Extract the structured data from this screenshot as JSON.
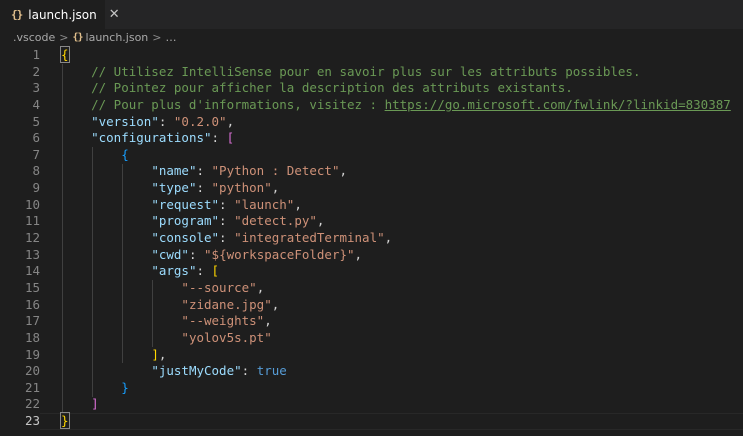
{
  "tab": {
    "icon": "{}",
    "label": "launch.json",
    "close": "✕"
  },
  "breadcrumb": {
    "folder": ".vscode",
    "sep": ">",
    "icon": "{}",
    "file": "launch.json",
    "rest": "…"
  },
  "editor": {
    "line_numbers": [
      "1",
      "2",
      "3",
      "4",
      "5",
      "6",
      "7",
      "8",
      "9",
      "10",
      "11",
      "12",
      "13",
      "14",
      "15",
      "16",
      "17",
      "18",
      "19",
      "20",
      "21",
      "22",
      "23"
    ],
    "lines": [
      [
        [
          "br1",
          "{",
          true
        ]
      ],
      [
        [
          "c",
          "    // Utilisez IntelliSense pour en savoir plus sur les attributs possibles."
        ]
      ],
      [
        [
          "c",
          "    // Pointez pour afficher la description des attributs existants."
        ]
      ],
      [
        [
          "c",
          "    // Pour plus d'informations, visitez : "
        ],
        [
          "u",
          "https://go.microsoft.com/fwlink/?linkid=830387"
        ]
      ],
      [
        [
          "p",
          "    "
        ],
        [
          "k",
          "\"version\""
        ],
        [
          "p",
          ": "
        ],
        [
          "s",
          "\"0.2.0\""
        ],
        [
          "p",
          ","
        ]
      ],
      [
        [
          "p",
          "    "
        ],
        [
          "k",
          "\"configurations\""
        ],
        [
          "p",
          ": "
        ],
        [
          "br2",
          "["
        ]
      ],
      [
        [
          "p",
          "        "
        ],
        [
          "br3",
          "{"
        ]
      ],
      [
        [
          "p",
          "            "
        ],
        [
          "k",
          "\"name\""
        ],
        [
          "p",
          ": "
        ],
        [
          "s",
          "\"Python : Detect\""
        ],
        [
          "p",
          ","
        ]
      ],
      [
        [
          "p",
          "            "
        ],
        [
          "k",
          "\"type\""
        ],
        [
          "p",
          ": "
        ],
        [
          "s",
          "\"python\""
        ],
        [
          "p",
          ","
        ]
      ],
      [
        [
          "p",
          "            "
        ],
        [
          "k",
          "\"request\""
        ],
        [
          "p",
          ": "
        ],
        [
          "s",
          "\"launch\""
        ],
        [
          "p",
          ","
        ]
      ],
      [
        [
          "p",
          "            "
        ],
        [
          "k",
          "\"program\""
        ],
        [
          "p",
          ": "
        ],
        [
          "s",
          "\"detect.py\""
        ],
        [
          "p",
          ","
        ]
      ],
      [
        [
          "p",
          "            "
        ],
        [
          "k",
          "\"console\""
        ],
        [
          "p",
          ": "
        ],
        [
          "s",
          "\"integratedTerminal\""
        ],
        [
          "p",
          ","
        ]
      ],
      [
        [
          "p",
          "            "
        ],
        [
          "k",
          "\"cwd\""
        ],
        [
          "p",
          ": "
        ],
        [
          "s",
          "\"${workspaceFolder}\""
        ],
        [
          "p",
          ","
        ]
      ],
      [
        [
          "p",
          "            "
        ],
        [
          "k",
          "\"args\""
        ],
        [
          "p",
          ": "
        ],
        [
          "br1",
          "["
        ]
      ],
      [
        [
          "p",
          "                "
        ],
        [
          "s",
          "\"--source\""
        ],
        [
          "p",
          ","
        ]
      ],
      [
        [
          "p",
          "                "
        ],
        [
          "s",
          "\"zidane.jpg\""
        ],
        [
          "p",
          ","
        ]
      ],
      [
        [
          "p",
          "                "
        ],
        [
          "s",
          "\"--weights\""
        ],
        [
          "p",
          ","
        ]
      ],
      [
        [
          "p",
          "                "
        ],
        [
          "s",
          "\"yolov5s.pt\""
        ]
      ],
      [
        [
          "p",
          "            "
        ],
        [
          "br1",
          "]"
        ],
        [
          "p",
          ","
        ]
      ],
      [
        [
          "p",
          "            "
        ],
        [
          "k",
          "\"justMyCode\""
        ],
        [
          "p",
          ": "
        ],
        [
          "b",
          "true"
        ]
      ],
      [
        [
          "p",
          "        "
        ],
        [
          "br3",
          "}"
        ]
      ],
      [
        [
          "p",
          "    "
        ],
        [
          "br2",
          "]"
        ]
      ],
      [
        [
          "br1",
          "}",
          true
        ]
      ]
    ]
  }
}
